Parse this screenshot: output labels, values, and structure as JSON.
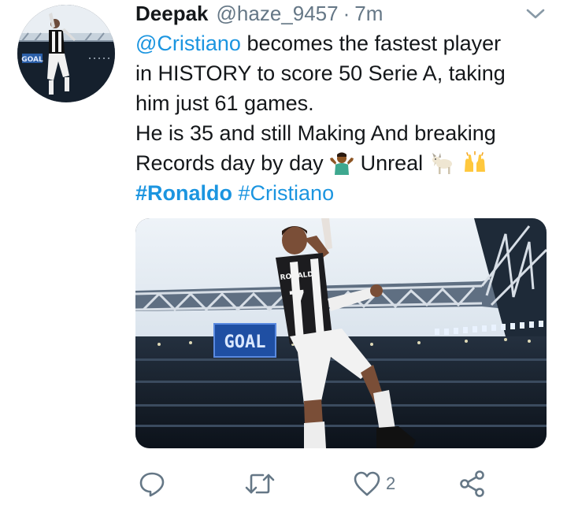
{
  "tweet": {
    "author_name": "Deepak",
    "handle": "@haze_9457",
    "separator": "·",
    "time": "7m",
    "text": {
      "mention": "@Cristiano",
      "line1_rest": " becomes the fastest player",
      "line2": "in HISTORY to score 50 Serie A, taking",
      "line3": "him just 61 games.",
      "line4": "He is 35 and still Making And breaking",
      "line5_a": "Records day by day ",
      "line5_b": " Unreal ",
      "hashtag1": "#Ronaldo",
      "hashtag2": "#Cristiano"
    },
    "emojis": [
      "person-shrugging-icon",
      "goat-icon",
      "raising-hands-icon"
    ],
    "media": {
      "scoreboard_text": "GOAL",
      "jersey_name": "RONALDO",
      "jersey_number": "7"
    },
    "avatar": {
      "scoreboard_text": "GOAL"
    },
    "actions": {
      "reply_icon": "reply-icon",
      "retweet_icon": "retweet-icon",
      "like_icon": "heart-icon",
      "like_count": "2",
      "share_icon": "share-icon"
    }
  },
  "colors": {
    "link": "#1b95e0",
    "secondary_text": "#657786",
    "icon": "#657786",
    "primary_text": "#14171a"
  }
}
